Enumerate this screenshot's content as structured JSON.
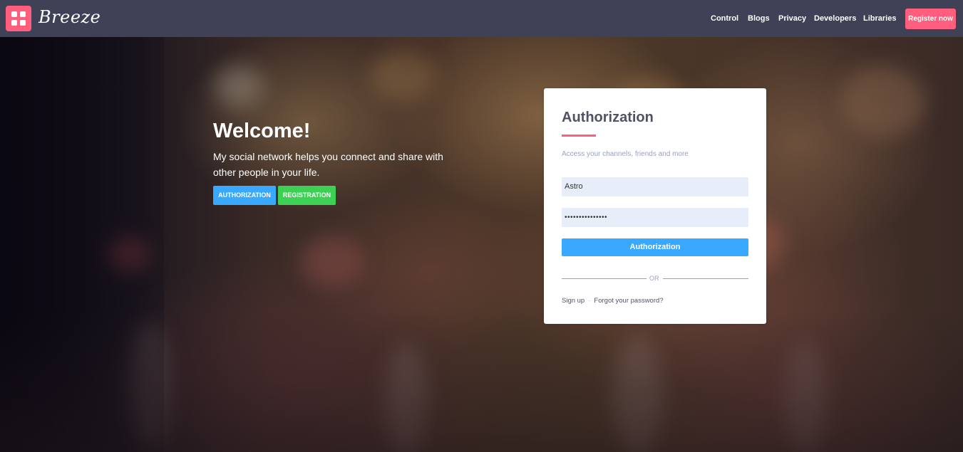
{
  "header": {
    "brand": "Breeze",
    "nav": [
      "Control",
      "Blogs",
      "Privacy",
      "Developers",
      "Libraries"
    ],
    "register_label": "Register now"
  },
  "hero": {
    "title": "Welcome!",
    "text": "My social network helps you connect and share with other people in your life.",
    "auth_button": "AUTHORIZATION",
    "register_button": "REGISTRATION"
  },
  "auth_card": {
    "title": "Authorization",
    "subtitle": "Access your channels, friends and more",
    "login_value": "Astro",
    "password_value": "•••••••••••••••",
    "submit_label": "Authorization",
    "or_label": "OR",
    "signup_label": "Sign up",
    "separator": "·",
    "forgot_label": "Forgot your password?"
  },
  "colors": {
    "header_bg": "#3f4257",
    "accent_pink": "#ff5e7e",
    "primary_blue": "#38a9ff",
    "success_green": "#3cd055",
    "field_bg": "#e7eefa"
  },
  "icons": {
    "logo": "breeze-logo-icon"
  }
}
